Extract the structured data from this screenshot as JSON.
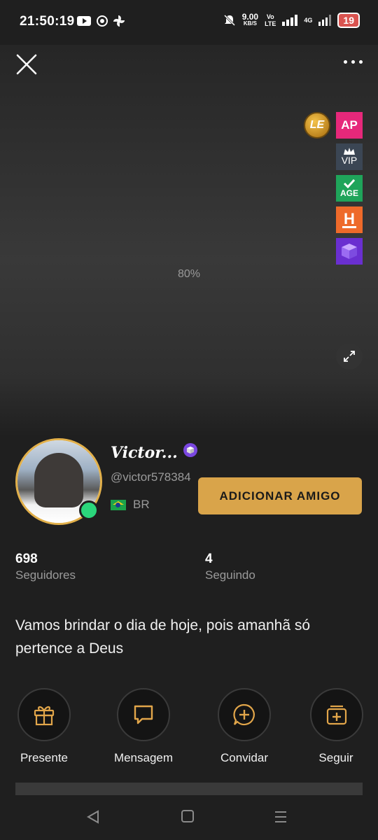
{
  "status_bar": {
    "time": "21:50:19",
    "speed_value": "9.00",
    "speed_unit": "KB/S",
    "volte_top": "Vo",
    "volte_bottom": "LTE",
    "network": "4G",
    "battery": "19"
  },
  "player": {
    "progress_text": "80%",
    "badges": {
      "le": "LE",
      "ap": "AP",
      "vip": "VIP",
      "age": "AGE",
      "h": "H"
    }
  },
  "profile": {
    "name": "Victor...",
    "handle": "@victor578384",
    "country": "BR",
    "add_friend_label": "ADICIONAR AMIGO",
    "followers_count": "698",
    "followers_label": "Seguidores",
    "following_count": "4",
    "following_label": "Seguindo",
    "bio": "Vamos brindar o dia de hoje, pois amanhã só pertence a Deus"
  },
  "actions": [
    {
      "label": "Presente",
      "icon": "gift-icon"
    },
    {
      "label": "Mensagem",
      "icon": "message-icon"
    },
    {
      "label": "Convidar",
      "icon": "invite-icon"
    },
    {
      "label": "Seguir",
      "icon": "follow-icon"
    }
  ],
  "colors": {
    "accent_gold": "#d9a44a",
    "online_green": "#2bd67b",
    "background": "#1f1f1f"
  }
}
